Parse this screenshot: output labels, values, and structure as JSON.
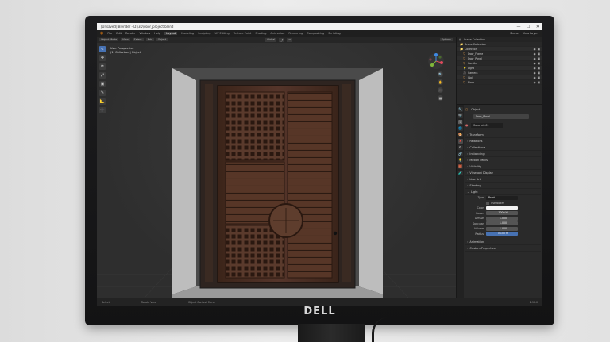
{
  "monitor": {
    "brand": "DELL"
  },
  "window": {
    "title": "[Unsaved] Blender - D:\\3D\\door_project.blend",
    "controls": [
      "—",
      "☐",
      "✕"
    ]
  },
  "menubar": {
    "menus": [
      "File",
      "Edit",
      "Render",
      "Window",
      "Help"
    ],
    "workspaces": [
      "Layout",
      "Modeling",
      "Sculpting",
      "UV Editing",
      "Texture Paint",
      "Shading",
      "Animation",
      "Rendering",
      "Compositing",
      "Scripting"
    ],
    "active_workspace": "Layout",
    "scene": "Scene",
    "view_layer": "View Layer"
  },
  "viewport": {
    "header": {
      "mode": "Object Mode",
      "menus": [
        "View",
        "Select",
        "Add",
        "Object"
      ],
      "orientation": "Global",
      "transform": "⤴",
      "snap": "⧉",
      "options": "Options"
    },
    "info_line1": "User Perspective",
    "info_line2": "(1) Collection | Object",
    "tools": [
      "↖",
      "✥",
      "⟳",
      "⤢",
      "▣",
      "✎",
      "📐",
      "➕"
    ],
    "nav_buttons": [
      "🔍",
      "✋",
      "🎥",
      "▦"
    ]
  },
  "statusbar": {
    "left": "Select",
    "middle": "Rotate View",
    "right": "Object Context Menu",
    "version": "2.90.0"
  },
  "outliner": {
    "header": "Scene Collection",
    "rows": [
      {
        "label": "Scene Collection",
        "icon": "📁"
      },
      {
        "label": "Collection",
        "icon": "📁"
      },
      {
        "label": "Door_Frame",
        "icon": "▽"
      },
      {
        "label": "Door_Panel",
        "icon": "▽"
      },
      {
        "label": "Handle",
        "icon": "▽"
      },
      {
        "label": "Light",
        "icon": "💡"
      },
      {
        "label": "Camera",
        "icon": "🎥"
      },
      {
        "label": "Wall",
        "icon": "▽"
      },
      {
        "label": "Floor",
        "icon": "▽"
      }
    ]
  },
  "properties": {
    "tabs": [
      "🔧",
      "📷",
      "🖼",
      "🌐",
      "🎨",
      "🔺",
      "⚙",
      "🔗",
      "💡",
      "🧱",
      "🧪"
    ],
    "object_label": "Object",
    "object_name": "Door_Panel",
    "material_slot": "Material.001",
    "sections": [
      "Transform",
      "Relations",
      "Collections",
      "Instancing",
      "Motion Paths",
      "Visibility",
      "Viewport Display",
      "Line Art",
      "Shading"
    ],
    "light_section": "Light",
    "light": {
      "type_label": "Type",
      "type_value": "Point",
      "use_nodes_label": "Use Nodes",
      "color_label": "Color",
      "power_label": "Power",
      "power_value": "1000 W",
      "diffuse_label": "Diffuse",
      "diffuse_value": "1.000",
      "specular_label": "Specular",
      "specular_value": "1.000",
      "volume_label": "Volume",
      "volume_value": "1.000",
      "radius_label": "Radius",
      "radius_value": "0.100 m"
    },
    "bottom_sections": [
      "Animation",
      "Custom Properties"
    ]
  },
  "colors": {
    "accent": "#4772b3",
    "wood": "#4a2e22",
    "panel": "#2a2a2a"
  }
}
